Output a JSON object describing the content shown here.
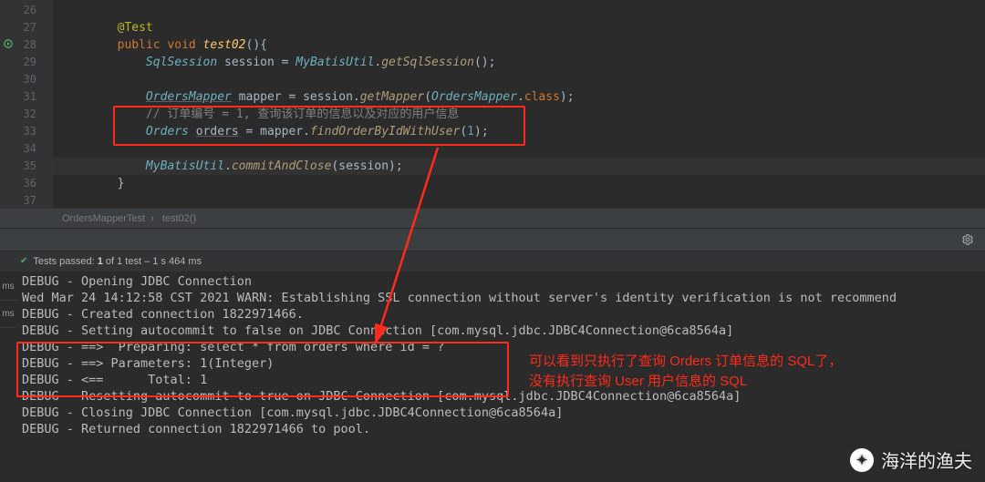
{
  "editor": {
    "line_start": 26,
    "lines": [
      {
        "n": 26,
        "segs": []
      },
      {
        "n": 27,
        "segs": [
          {
            "t": "        ",
            "c": ""
          },
          {
            "t": "@Test",
            "c": "tok-ann"
          }
        ]
      },
      {
        "n": 28,
        "segs": [
          {
            "t": "        ",
            "c": ""
          },
          {
            "t": "public void ",
            "c": "tok-kw"
          },
          {
            "t": "test02",
            "c": "tok-fn"
          },
          {
            "t": "(){",
            "c": "tok-pun"
          }
        ],
        "run_icon": true
      },
      {
        "n": 29,
        "segs": [
          {
            "t": "            ",
            "c": ""
          },
          {
            "t": "SqlSession",
            "c": "tok-typ2"
          },
          {
            "t": " session = ",
            "c": "tok-var"
          },
          {
            "t": "MyBatisUtil",
            "c": "tok-typ2"
          },
          {
            "t": ".",
            "c": "tok-pun"
          },
          {
            "t": "getSqlSession",
            "c": "tok-call"
          },
          {
            "t": "();",
            "c": "tok-pun"
          }
        ]
      },
      {
        "n": 30,
        "segs": []
      },
      {
        "n": 31,
        "segs": [
          {
            "t": "            ",
            "c": ""
          },
          {
            "t": "OrdersMapper",
            "c": "tok-typ2 tok-und"
          },
          {
            "t": " mapper = session.",
            "c": "tok-var"
          },
          {
            "t": "getMapper",
            "c": "tok-call"
          },
          {
            "t": "(",
            "c": "tok-pun"
          },
          {
            "t": "OrdersMapper",
            "c": "tok-typ2"
          },
          {
            "t": ".",
            "c": "tok-pun"
          },
          {
            "t": "class",
            "c": "tok-kw"
          },
          {
            "t": ");",
            "c": "tok-pun"
          }
        ]
      },
      {
        "n": 32,
        "segs": [
          {
            "t": "            ",
            "c": ""
          },
          {
            "t": "// 订单编号 = 1, 查询该订单的信息以及对应的用户信息",
            "c": "tok-cmt"
          }
        ]
      },
      {
        "n": 33,
        "segs": [
          {
            "t": "            ",
            "c": ""
          },
          {
            "t": "Orders",
            "c": "tok-typ2"
          },
          {
            "t": " ",
            "c": ""
          },
          {
            "t": "orders",
            "c": "tok-var tok-und"
          },
          {
            "t": " = mapper.",
            "c": "tok-var"
          },
          {
            "t": "findOrderByIdWithUser",
            "c": "tok-call"
          },
          {
            "t": "(",
            "c": "tok-pun"
          },
          {
            "t": "1",
            "c": "tok-num"
          },
          {
            "t": ");",
            "c": "tok-pun"
          }
        ]
      },
      {
        "n": 34,
        "segs": []
      },
      {
        "n": 35,
        "segs": [
          {
            "t": "            ",
            "c": ""
          },
          {
            "t": "MyBatisUtil",
            "c": "tok-typ2"
          },
          {
            "t": ".",
            "c": "tok-pun"
          },
          {
            "t": "commitAndClose",
            "c": "tok-call"
          },
          {
            "t": "(session)",
            "c": "tok-var"
          },
          {
            "t": ";",
            "c": "tok-pun"
          }
        ],
        "hl": true
      },
      {
        "n": 36,
        "segs": [
          {
            "t": "        ",
            "c": ""
          },
          {
            "t": "}",
            "c": "tok-pun"
          }
        ]
      },
      {
        "n": 37,
        "segs": []
      }
    ]
  },
  "breadcrumb": {
    "a": "OrdersMapperTest",
    "b": "test02()"
  },
  "test_status": {
    "label_prefix": "Tests passed:",
    "count": "1",
    "of_label": "of 1 test",
    "time": "– 1 s 464 ms"
  },
  "console_lines": [
    "DEBUG - Opening JDBC Connection",
    "Wed Mar 24 14:12:58 CST 2021 WARN: Establishing SSL connection without server's identity verification is not recommend",
    "DEBUG - Created connection 1822971466.",
    "DEBUG - Setting autocommit to false on JDBC Connection [com.mysql.jdbc.JDBC4Connection@6ca8564a]",
    "DEBUG - ==>  Preparing: select * from orders where id = ?",
    "DEBUG - ==> Parameters: 1(Integer)",
    "DEBUG - <==      Total: 1",
    "DEBUG - Resetting autocommit to true on JDBC Connection [com.mysql.jdbc.JDBC4Connection@6ca8564a]",
    "DEBUG - Closing JDBC Connection [com.mysql.jdbc.JDBC4Connection@6ca8564a]",
    "DEBUG - Returned connection 1822971466 to pool."
  ],
  "annotation": {
    "line1": "可以看到只执行了查询 Orders 订单信息的 SQL了，",
    "line2": "没有执行查询 User 用户信息的 SQL"
  },
  "watermark": "海洋的渔夫",
  "side_tabs": [
    "ms",
    "ms"
  ]
}
